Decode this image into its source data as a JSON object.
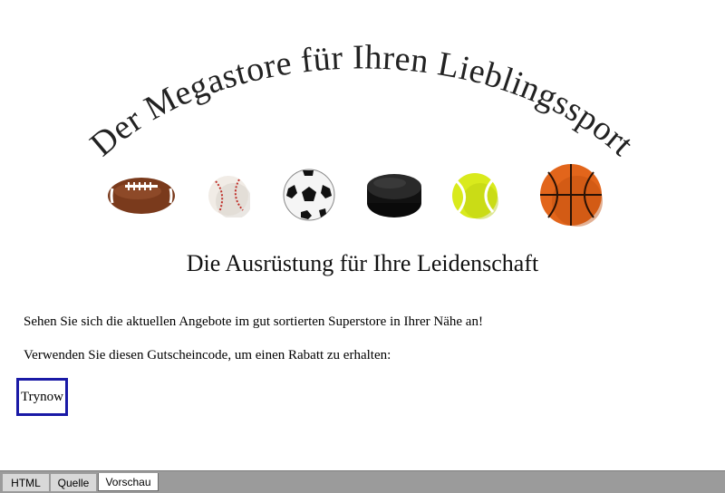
{
  "header": {
    "arc_title": "Der Megastore für Ihren Lieblingssport",
    "subtitle": "Die Ausrüstung für Ihre Leidenschaft"
  },
  "balls": [
    "american-football-icon",
    "baseball-icon",
    "soccer-ball-icon",
    "hockey-puck-icon",
    "tennis-ball-icon",
    "basketball-icon"
  ],
  "content": {
    "offer_text": "Sehen Sie sich die aktuellen Angebote im gut sortierten Superstore in Ihrer Nähe an!",
    "coupon_text": "Verwenden Sie diesen Gutscheincode, um einen Rabatt zu erhalten:",
    "coupon_code": "Trynow"
  },
  "tabs": [
    {
      "label": "HTML",
      "active": false
    },
    {
      "label": "Quelle",
      "active": false
    },
    {
      "label": "Vorschau",
      "active": true
    }
  ],
  "colors": {
    "coupon_border": "#1a1aa6",
    "tabbar": "#9b9b9b"
  }
}
